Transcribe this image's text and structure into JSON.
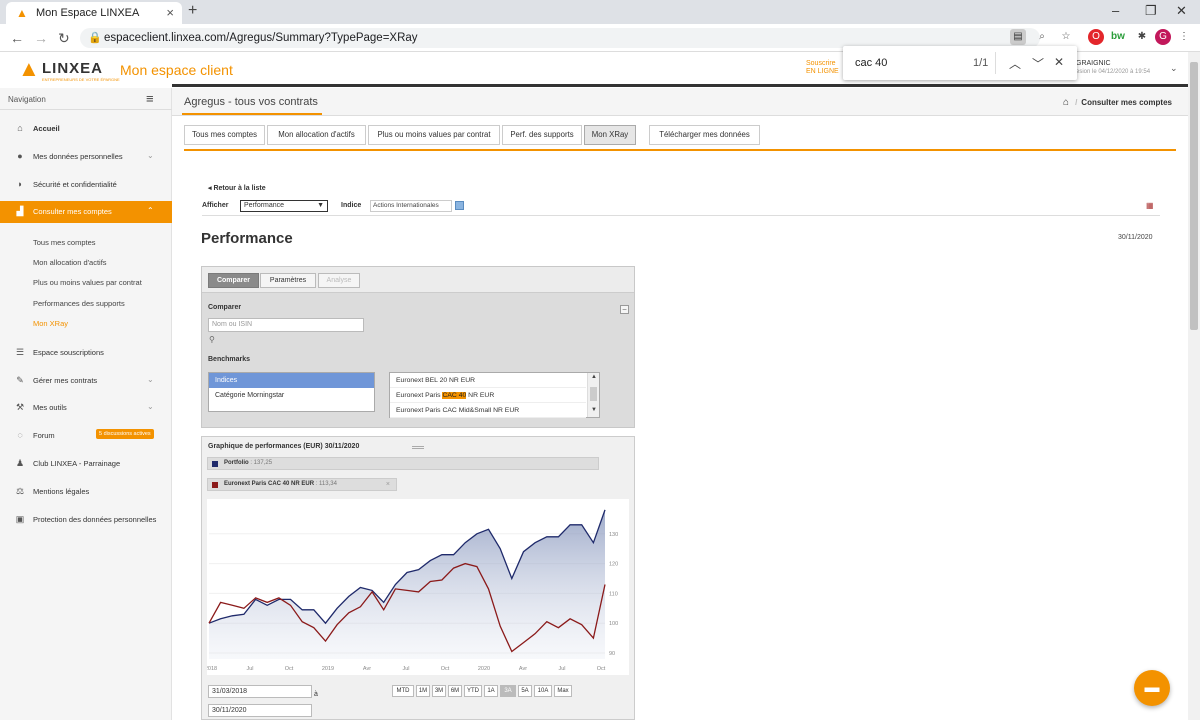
{
  "browser": {
    "tab_title": "Mon Espace LINXEA",
    "url": "espaceclient.linxea.com/Agregus/Summary?TypePage=XRay",
    "profile_initial": "G"
  },
  "find_bar": {
    "query": "cac 40",
    "count": "1/1"
  },
  "header": {
    "logo_text": "LINXEA",
    "logo_tagline": "ENTREPRENEURS DE VOTRE ÉPARGNE",
    "space_title": "Mon espace client",
    "souscrire_line1": "Souscrire",
    "souscrire_line2": "EN LIGNE",
    "user_name": "GRAIGNIC",
    "user_session": "esion le 04/12/2020 à 19:54"
  },
  "sidebar": {
    "nav_label": "Navigation",
    "items": [
      {
        "label": "Accueil",
        "icon": "home-icon"
      },
      {
        "label": "Mes données personnelles",
        "icon": "user-icon"
      },
      {
        "label": "Sécurité et confidentialité",
        "icon": "shield-icon"
      },
      {
        "label": "Consulter mes comptes",
        "icon": "chart-icon"
      },
      {
        "label": "Espace souscriptions",
        "icon": "list-icon"
      },
      {
        "label": "Gérer mes contrats",
        "icon": "edit-icon"
      },
      {
        "label": "Mes outils",
        "icon": "wrench-icon"
      },
      {
        "label": "Forum",
        "icon": "chat-icon"
      },
      {
        "label": "Club LINXEA - Parrainage",
        "icon": "group-icon"
      },
      {
        "label": "Mentions légales",
        "icon": "scale-icon"
      },
      {
        "label": "Protection des données personnelles",
        "icon": "id-card-icon"
      }
    ],
    "subitems": [
      "Tous mes comptes",
      "Mon allocation d'actifs",
      "Plus ou moins values par contrat",
      "Performances des supports",
      "Mon XRay"
    ],
    "forum_badge": "5 discussions actives"
  },
  "page": {
    "title": "Agregus - tous vos contrats",
    "breadcrumb": "Consulter mes comptes",
    "tabs": [
      "Tous mes comptes",
      "Mon allocation d'actifs",
      "Plus ou moins values par contrat",
      "Perf. des supports",
      "Mon XRay"
    ],
    "download_tab": "Télécharger mes données",
    "retour": "Retour à la liste",
    "afficher_label": "Afficher",
    "afficher_value": "Performance",
    "indice_label": "Indice",
    "indice_value": "Actions Internationales",
    "heading": "Performance",
    "date": "30/11/2020"
  },
  "compare": {
    "tabs": [
      "Comparer",
      "Paramètres",
      "Analyse"
    ],
    "section_label": "Comparer",
    "search_placeholder": "Nom ou ISIN",
    "benchmarks_label": "Benchmarks",
    "left_list": [
      "Indices",
      "Catégorie Morningstar"
    ],
    "right_list": [
      {
        "pre": "Euronext BEL 20 NR EUR",
        "hl": "",
        "post": ""
      },
      {
        "pre": "Euronext Paris ",
        "hl": "CAC 40",
        "post": " NR EUR"
      },
      {
        "pre": "Euronext Paris CAC Mid&Small NR EUR",
        "hl": "",
        "post": ""
      }
    ]
  },
  "chart_panel": {
    "title": "Graphique de performances (EUR)  30/11/2020",
    "legend": [
      {
        "name": "Portfolio",
        "value": ": 137,25",
        "color": "#1f2a6b"
      },
      {
        "name": "Euronext Paris CAC 40 NR EUR",
        "value": ": 113,34",
        "color": "#8b1a1a"
      }
    ],
    "start_date": "31/03/2018",
    "end_date": "30/11/2020",
    "a_label": "à",
    "ranges": [
      "MTD",
      "1M",
      "3M",
      "6M",
      "YTD",
      "1A",
      "3A",
      "5A",
      "10A",
      "Max"
    ],
    "selected_range": "3A"
  },
  "chart_data": {
    "type": "area",
    "x_ticks": [
      "2018",
      "Jul",
      "Oct",
      "2019",
      "Avr",
      "Jul",
      "Oct",
      "2020",
      "Avr",
      "Jul",
      "Oct"
    ],
    "y_ticks": [
      90,
      100,
      110,
      120,
      130
    ],
    "ylim": [
      88,
      141
    ],
    "series": [
      {
        "name": "Portfolio",
        "color": "#1f2a6b",
        "values": [
          100,
          101.5,
          102.5,
          103,
          108,
          106,
          108,
          108,
          104.5,
          104.5,
          100,
          105,
          109,
          112,
          111,
          107,
          113,
          117,
          118,
          121,
          123,
          123,
          127,
          130,
          131.5,
          125,
          115,
          124,
          127,
          129,
          129,
          133,
          133,
          127,
          138
        ]
      },
      {
        "name": "Euronext Paris CAC 40 NR EUR",
        "color": "#8b1a1a",
        "values": [
          100,
          107,
          106,
          105,
          108.5,
          107,
          108.5,
          106,
          100.5,
          98.5,
          94,
          99.5,
          103.5,
          105.5,
          110.5,
          104.5,
          111.5,
          111,
          110.5,
          114,
          114.5,
          118.5,
          120,
          119,
          111.5,
          99,
          90.5,
          93.5,
          96.5,
          100.5,
          98.5,
          101.5,
          99.5,
          95,
          113
        ]
      }
    ]
  }
}
